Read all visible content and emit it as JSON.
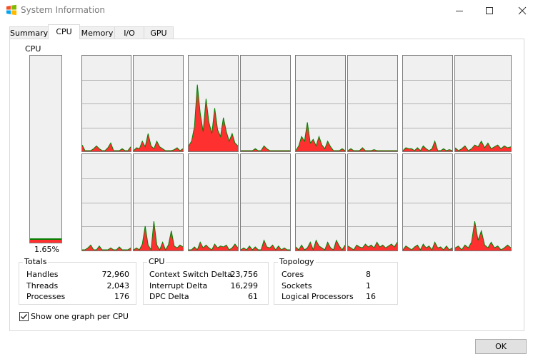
{
  "window": {
    "title": "System Information"
  },
  "tabs": [
    {
      "label": "Summary",
      "active": false
    },
    {
      "label": "CPU",
      "active": true
    },
    {
      "label": "Memory",
      "active": false
    },
    {
      "label": "I/O",
      "active": false
    },
    {
      "label": "GPU",
      "active": false
    }
  ],
  "cpu": {
    "label": "CPU",
    "usage_text": "1.65%",
    "usage_fraction": 0.0165
  },
  "colors": {
    "graph_fill": "#ff3030",
    "graph_line": "#008000",
    "grid": "#b4b4b4",
    "graph_bg": "#f0f0f0"
  },
  "cpu_graphs": [
    [
      0.06,
      0,
      0,
      0,
      0.02,
      0.05,
      0.02,
      0,
      0,
      0.03,
      0.08,
      0,
      0,
      0,
      0.02,
      0,
      0,
      0.04
    ],
    [
      0,
      0.03,
      0.02,
      0.1,
      0.04,
      0.18,
      0.05,
      0.02,
      0.1,
      0.04,
      0.02,
      0,
      0,
      0,
      0.01,
      0.03,
      0,
      0.02
    ],
    [
      0.05,
      0.1,
      0.25,
      0.7,
      0.4,
      0.2,
      0.55,
      0.3,
      0.18,
      0.45,
      0.22,
      0.15,
      0.35,
      0.2,
      0.1,
      0.18,
      0.08,
      0.05
    ],
    [
      0,
      0,
      0,
      0,
      0,
      0.02,
      0,
      0,
      0.05,
      0.02,
      0,
      0,
      0,
      0,
      0,
      0,
      0,
      0
    ],
    [
      0,
      0.05,
      0.15,
      0.1,
      0.3,
      0.08,
      0.12,
      0.05,
      0.15,
      0.06,
      0.02,
      0.1,
      0.04,
      0,
      0,
      0,
      0.02,
      0
    ],
    [
      0,
      0.02,
      0,
      0,
      0,
      0.03,
      0,
      0,
      0,
      0.01,
      0,
      0,
      0,
      0,
      0,
      0,
      0,
      0
    ],
    [
      0,
      0.03,
      0.02,
      0.02,
      0,
      0.03,
      0,
      0.05,
      0.02,
      0,
      0.02,
      0.1,
      0,
      0,
      0.02,
      0,
      0.01,
      0
    ],
    [
      0.03,
      0,
      0.02,
      0.05,
      0,
      0.02,
      0.06,
      0.04,
      0.1,
      0.03,
      0.08,
      0.02,
      0.04,
      0.06,
      0.02,
      0.05,
      0.03,
      0.04
    ],
    [
      0,
      0,
      0.02,
      0.05,
      0,
      0,
      0.04,
      0,
      0,
      0,
      0.02,
      0,
      0,
      0.03,
      0,
      0,
      0,
      0.02
    ],
    [
      0,
      0.02,
      0,
      0.06,
      0.25,
      0.05,
      0,
      0.3,
      0.05,
      0,
      0.08,
      0,
      0.05,
      0.2,
      0.04,
      0.02,
      0.05,
      0.03
    ],
    [
      0,
      0,
      0.03,
      0,
      0.08,
      0.02,
      0.05,
      0.02,
      0,
      0.06,
      0.02,
      0.04,
      0.03,
      0.05,
      0,
      0.02,
      0.06,
      0.02
    ],
    [
      0,
      0.02,
      0,
      0.04,
      0,
      0.03,
      0,
      0,
      0.1,
      0.03,
      0.02,
      0.05,
      0,
      0.04,
      0,
      0.02,
      0,
      0
    ],
    [
      0.03,
      0,
      0.05,
      0,
      0.02,
      0.08,
      0,
      0.1,
      0.04,
      0.02,
      0,
      0.08,
      0.02,
      0,
      0.1,
      0.04,
      0,
      0.05
    ],
    [
      0.04,
      0.02,
      0,
      0.05,
      0.03,
      0.02,
      0.06,
      0.03,
      0.05,
      0.02,
      0.08,
      0.03,
      0.05,
      0.02,
      0.04,
      0.06,
      0.03,
      0.08
    ],
    [
      0,
      0.04,
      0.02,
      0,
      0.03,
      0.05,
      0,
      0.06,
      0.02,
      0.04,
      0,
      0.08,
      0.02,
      0.03,
      0,
      0.04,
      0,
      0.02
    ],
    [
      0.02,
      0.04,
      0,
      0.05,
      0.02,
      0.08,
      0.3,
      0.1,
      0.2,
      0.05,
      0.02,
      0.08,
      0.02,
      0.04,
      0,
      0.02,
      0.05,
      0.02
    ]
  ],
  "totals": {
    "title": "Totals",
    "rows": [
      {
        "label": "Handles",
        "value": "72,960"
      },
      {
        "label": "Threads",
        "value": "2,043"
      },
      {
        "label": "Processes",
        "value": "176"
      }
    ]
  },
  "cpu_stats": {
    "title": "CPU",
    "rows": [
      {
        "label": "Context Switch Delta",
        "value": "23,756"
      },
      {
        "label": "Interrupt Delta",
        "value": "16,299"
      },
      {
        "label": "DPC Delta",
        "value": "61"
      }
    ]
  },
  "topology": {
    "title": "Topology",
    "rows": [
      {
        "label": "Cores",
        "value": "8"
      },
      {
        "label": "Sockets",
        "value": "1"
      },
      {
        "label": "Logical Processors",
        "value": "16"
      }
    ]
  },
  "options": {
    "show_one_graph_label": "Show one graph per CPU",
    "show_one_graph_checked": true
  },
  "buttons": {
    "ok": "OK"
  }
}
